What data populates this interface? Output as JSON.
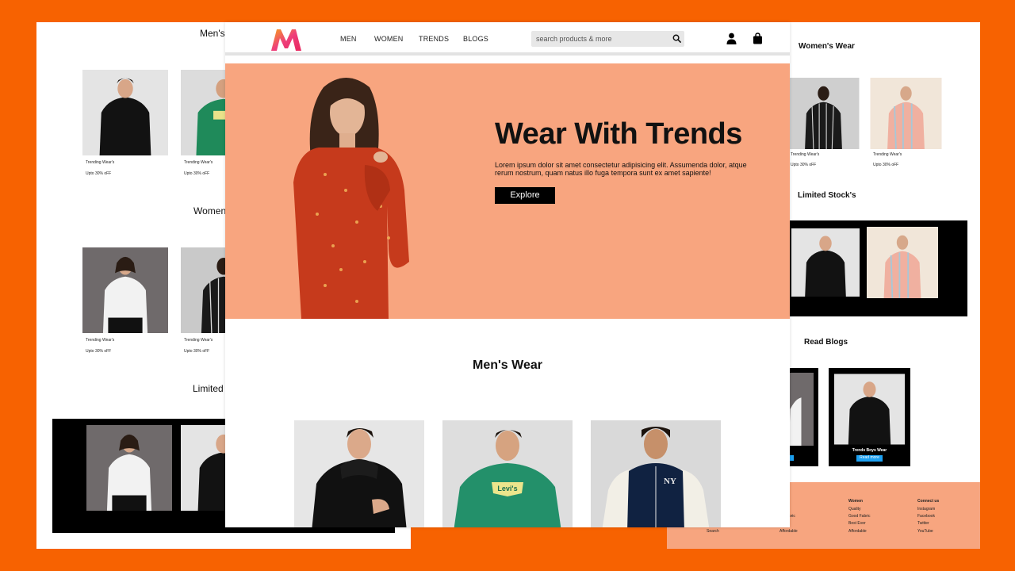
{
  "left_page": {
    "mens_heading": "Men's",
    "womens_heading": "Women'",
    "limited_heading": "Limited",
    "cards": [
      {
        "caption": "Trending Wear's",
        "offer": "Upto 30% oFF"
      },
      {
        "caption": "Trending Wear's",
        "offer": "Upto 30% oFF"
      },
      {
        "caption": "Trending Wear's",
        "offer": "Upto 30% oFF"
      },
      {
        "caption": "Trending Wear's",
        "offer": "Upto 30% oFF"
      }
    ]
  },
  "right_page": {
    "womens_heading": "Women's Wear",
    "limited_heading": "Limited Stock's",
    "blogs_heading": "Read Blogs",
    "cards": [
      {
        "caption": "Trending Wear's",
        "offer": "Upto 30% oFF"
      },
      {
        "caption": "Trending Wear's",
        "offer": "Upto 30% oFF"
      }
    ],
    "blog": {
      "title": "Trends Boys Wear",
      "button": "Read more"
    },
    "footer": {
      "columns": [
        {
          "heading": "",
          "links": [
            "y",
            "Fabric",
            "ver",
            "Search"
          ]
        },
        {
          "heading": "",
          "links": [
            "Affordable"
          ]
        },
        {
          "heading": "Women",
          "links": [
            "Quality",
            "Good Fabric",
            "Best Ever",
            "Affordable"
          ]
        },
        {
          "heading": "Connect us",
          "links": [
            "Instagram",
            "Facebook",
            "Twitter",
            "YouTube"
          ]
        }
      ]
    }
  },
  "nav": {
    "links": [
      "MEN",
      "WOMEN",
      "TRENDS",
      "BLOGS"
    ],
    "search_placeholder": "search products & more"
  },
  "hero": {
    "title": "Wear With Trends",
    "text": "Lorem ipsum dolor sit amet consectetur adipisicing elit. Assumenda dolor, atque rerum nostrum, quam natus illo fuga tempora sunt ex amet sapiente!",
    "button": "Explore"
  },
  "mens_section": {
    "title": "Men's Wear"
  },
  "colors": {
    "background": "#f76201",
    "hero": "#f8a57f",
    "accent_button": "#1da1f2"
  }
}
